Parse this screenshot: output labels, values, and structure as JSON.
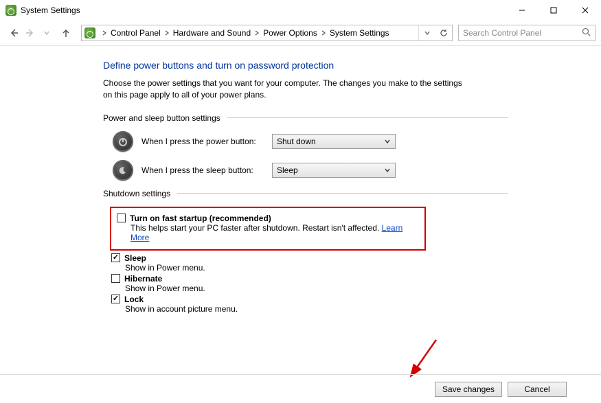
{
  "window": {
    "title": "System Settings"
  },
  "breadcrumbs": {
    "items": [
      "Control Panel",
      "Hardware and Sound",
      "Power Options",
      "System Settings"
    ]
  },
  "search": {
    "placeholder": "Search Control Panel"
  },
  "heading": "Define power buttons and turn on password protection",
  "description": "Choose the power settings that you want for your computer. The changes you make to the settings on this page apply to all of your power plans.",
  "section1": {
    "title": "Power and sleep button settings",
    "power_label": "When I press the power button:",
    "power_value": "Shut down",
    "sleep_label": "When I press the sleep button:",
    "sleep_value": "Sleep"
  },
  "section2": {
    "title": "Shutdown settings",
    "fast_startup": {
      "label": "Turn on fast startup (recommended)",
      "desc_prefix": "This helps start your PC faster after shutdown. Restart isn't affected. ",
      "learn_more": "Learn More",
      "checked": false
    },
    "sleep": {
      "label": "Sleep",
      "desc": "Show in Power menu.",
      "checked": true
    },
    "hibernate": {
      "label": "Hibernate",
      "desc": "Show in Power menu.",
      "checked": false
    },
    "lock": {
      "label": "Lock",
      "desc": "Show in account picture menu.",
      "checked": true
    }
  },
  "footer": {
    "save": "Save changes",
    "cancel": "Cancel"
  }
}
